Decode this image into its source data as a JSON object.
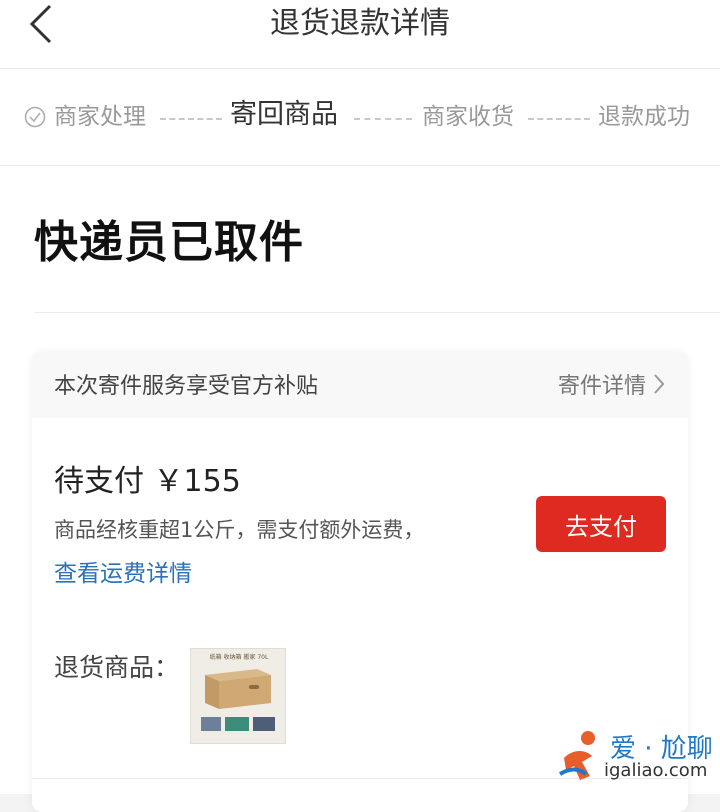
{
  "header": {
    "title": "退货退款详情"
  },
  "steps": [
    {
      "label": "商家处理",
      "done": true
    },
    {
      "label": "寄回商品",
      "active": true
    },
    {
      "label": "商家收货"
    },
    {
      "label": "退款成功"
    }
  ],
  "status": {
    "text": "快递员已取件"
  },
  "card": {
    "subsidy_text": "本次寄件服务享受官方补贴",
    "shipping_detail_link": "寄件详情",
    "payment": {
      "title": "待支付 ￥155",
      "description": "商品经核重超1公斤，需支付额外运费，",
      "fee_link": "查看运费详情",
      "pay_button": "去支付"
    },
    "return_goods_label": "退货商品：",
    "thumbnail_caption": "纸箱 收纳箱 搬家 70L"
  },
  "watermark": {
    "brand": "爱 · 尬聊",
    "url": "igaliao.com"
  },
  "colors": {
    "accent_red": "#df2a22",
    "link_blue": "#2a71b8"
  }
}
